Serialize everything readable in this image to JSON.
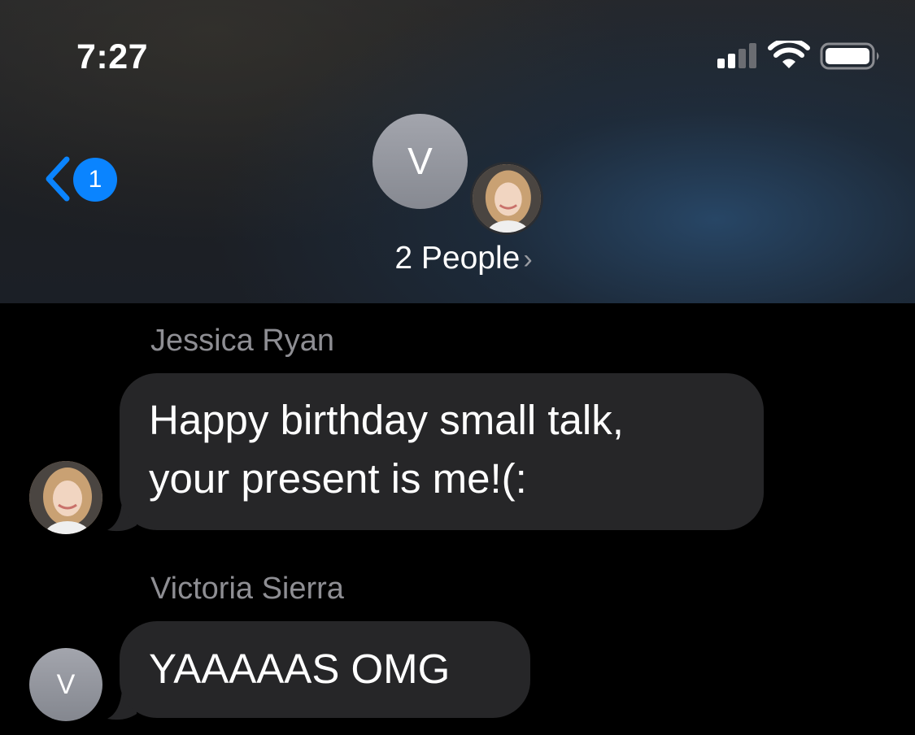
{
  "status_bar": {
    "time": "7:27",
    "icons": [
      "signal-icon",
      "wifi-icon",
      "battery-icon"
    ]
  },
  "nav": {
    "back_badge_count": "1",
    "group_avatar_initial": "V",
    "people_label": "2 People",
    "people_chevron": "›"
  },
  "messages": [
    {
      "sender": "Jessica Ryan",
      "lines": [
        "Happy birthday small talk,",
        "your present is me!(:"
      ],
      "avatar": "photo"
    },
    {
      "sender": "Victoria Sierra",
      "lines": [
        "YAAAAAS OMG"
      ],
      "avatar_initial": "V"
    }
  ],
  "colors": {
    "accent": "#0a84ff",
    "bubble": "#262628",
    "sender_name": "#8e8e93",
    "background": "#000000"
  }
}
